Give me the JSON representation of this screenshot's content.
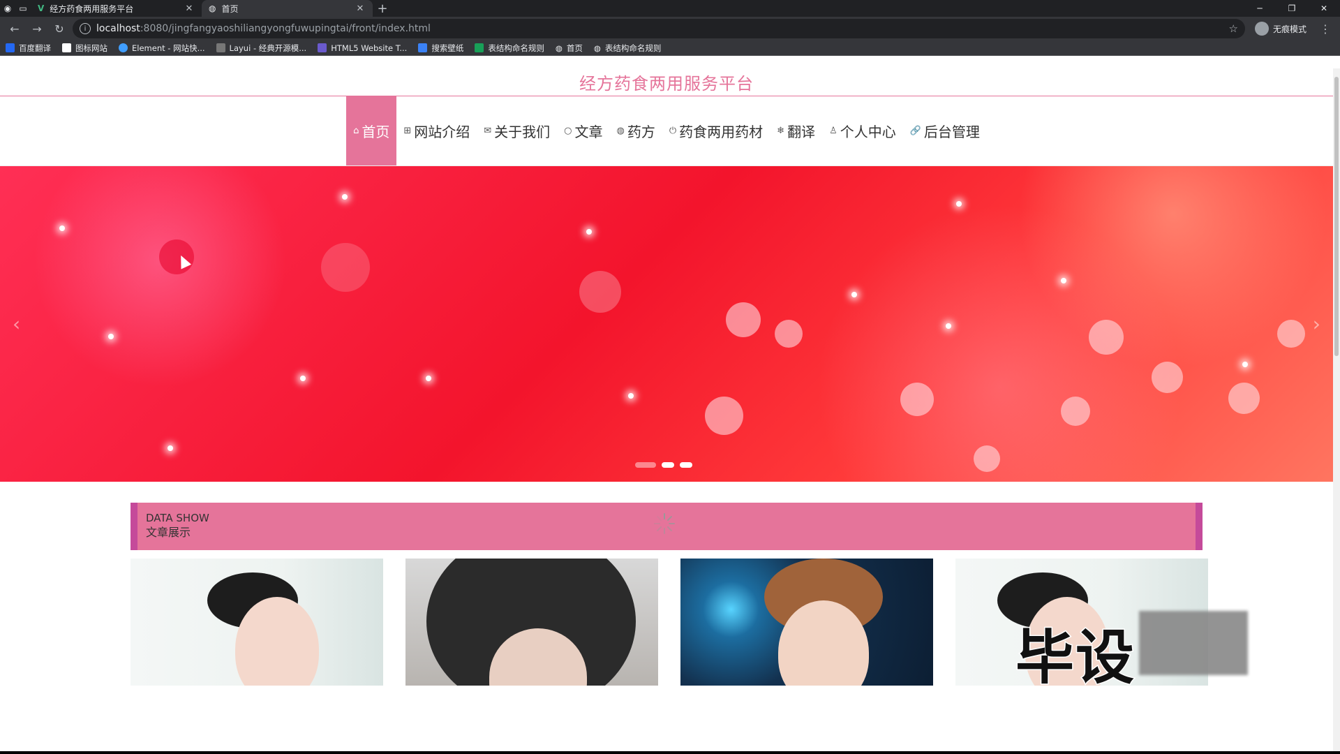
{
  "browser": {
    "tabs": [
      {
        "title": "经方药食两用服务平台",
        "icon": "vue-logo-icon"
      },
      {
        "title": "首页",
        "icon": "globe-icon"
      }
    ],
    "active_tab": 1,
    "url_host": "localhost",
    "url_path": ":8080/jingfangyaoshiliangyongfuwupingtai/front/index.html",
    "profile_label": "无痕模式",
    "bookmarks": [
      {
        "label": "百度翻译",
        "color": "#2468f2"
      },
      {
        "label": "图标网站",
        "color": "#ffffff"
      },
      {
        "label": "Element - 网站快...",
        "color": "#409eff"
      },
      {
        "label": "Layui - 经典开源模...",
        "color": "#999999"
      },
      {
        "label": "HTML5 Website T...",
        "color": "#6a5acd"
      },
      {
        "label": "搜索壁纸",
        "color": "#3b82f6"
      },
      {
        "label": "表结构命名规则",
        "color": "#18a058"
      },
      {
        "label": "首页",
        "color": "#e8eaed"
      },
      {
        "label": "表结构命名规则",
        "color": "#e8eaed"
      }
    ]
  },
  "site": {
    "title": "经方药食两用服务平台",
    "accent_color": "#e5749a",
    "nav": [
      {
        "icon": "home-icon",
        "glyph": "⌂",
        "label": "首页",
        "active": true
      },
      {
        "icon": "grid-icon",
        "glyph": "⊞",
        "label": "网站介绍",
        "active": false
      },
      {
        "icon": "mail-icon",
        "glyph": "✉",
        "label": "关于我们",
        "active": false
      },
      {
        "icon": "chat-icon",
        "glyph": "○",
        "label": "文章",
        "active": false
      },
      {
        "icon": "globe-icon",
        "glyph": "◍",
        "label": "药方",
        "active": false
      },
      {
        "icon": "power-icon",
        "glyph": "⏻",
        "label": "药食两用药材",
        "active": false
      },
      {
        "icon": "snowflake-icon",
        "glyph": "❄",
        "label": "翻译",
        "active": false
      },
      {
        "icon": "user-icon",
        "glyph": "♙",
        "label": "个人中心",
        "active": false
      },
      {
        "icon": "link-icon",
        "glyph": "🔗",
        "label": "后台管理",
        "active": false
      }
    ],
    "carousel": {
      "slides": 3,
      "active_index": 0
    },
    "section": {
      "en": "DATA SHOW",
      "zh": "文章展示"
    },
    "watermark": "毕设"
  }
}
